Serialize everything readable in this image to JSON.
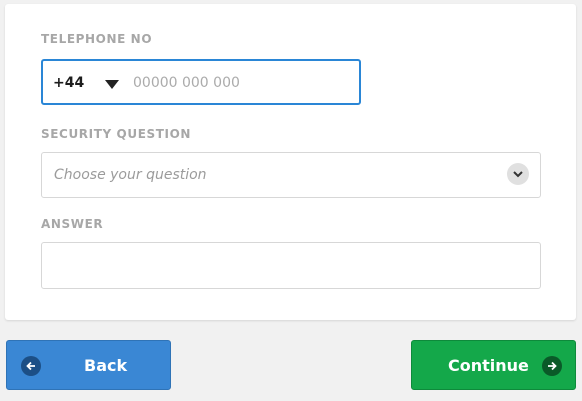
{
  "form": {
    "telephone": {
      "label": "TELEPHONE NO",
      "country_code": "+44",
      "placeholder": "00000 000 000",
      "value": ""
    },
    "security_question": {
      "label": "SECURITY QUESTION",
      "placeholder": "Choose your question"
    },
    "answer": {
      "label": "ANSWER",
      "value": ""
    }
  },
  "buttons": {
    "back_label": "Back",
    "continue_label": "Continue"
  },
  "colors": {
    "focus_border": "#2a86d6",
    "back_button": "#3a87d4",
    "continue_button": "#14a84a",
    "label_text": "#a7a7a7"
  },
  "icons": {
    "country_caret": "caret-down-icon",
    "select_chevron": "chevron-down-icon",
    "back": "arrow-left-icon",
    "continue": "arrow-right-icon"
  }
}
